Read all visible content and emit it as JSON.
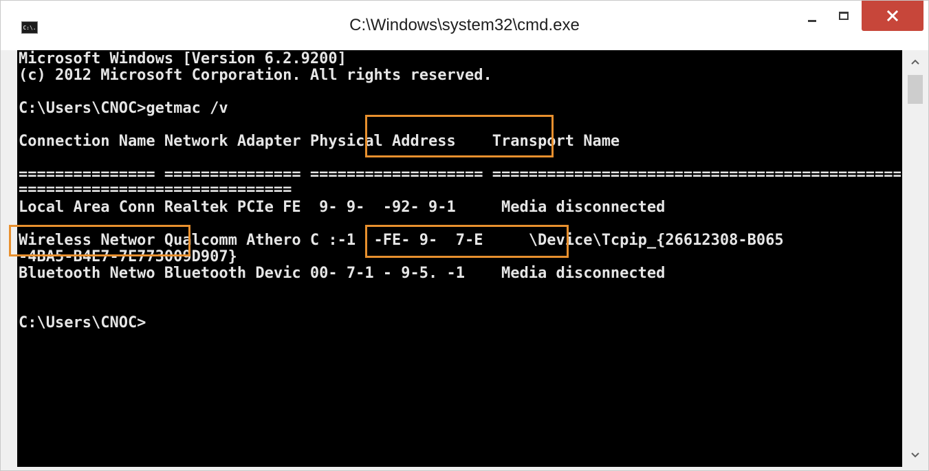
{
  "window": {
    "title": "C:\\Windows\\system32\\cmd.exe",
    "icon_text": "C:\\.",
    "controls": {
      "minimize": "minimize-icon",
      "maximize": "maximize-icon",
      "close": "close-icon"
    },
    "close_color": "#c7463a"
  },
  "console": {
    "lines": [
      "Microsoft Windows [Version 6.2.9200]",
      "(c) 2012 Microsoft Corporation. All rights reserved.",
      "",
      "C:\\Users\\CNOC>getmac /v",
      "",
      "Connection Name Network Adapter Physical Address    Transport Name",
      "",
      "=============== =============== =================== ==========================================================",
      "==============================",
      "Local Area Conn Realtek PCIe FE ​ 9- ​9- ​ -92- ​9-1 ​    Media disconnected",
      "Wireless Networ Qualcomm Athero C :-1  -FE- ​9-  7-E     \\Device\\Tcpip_{26612308-B065",
      "-4BA5-B4E7-7E773009D907}",
      "Bluetooth Netwo Bluetooth Devic 00- ​7-1 ​- ​9-5. ​-1    Media disconnected",
      "",
      "",
      "C:\\Users\\CNOC>"
    ],
    "background": "#000000",
    "text_color": "#e8e8e8"
  },
  "annotations": {
    "color": "#e8902e",
    "items": [
      "physical-address-header",
      "wireless-connection-name",
      "wireless-mac-address"
    ]
  },
  "scrollbar": {
    "up": "chevron-up-icon",
    "down": "chevron-down-icon"
  }
}
